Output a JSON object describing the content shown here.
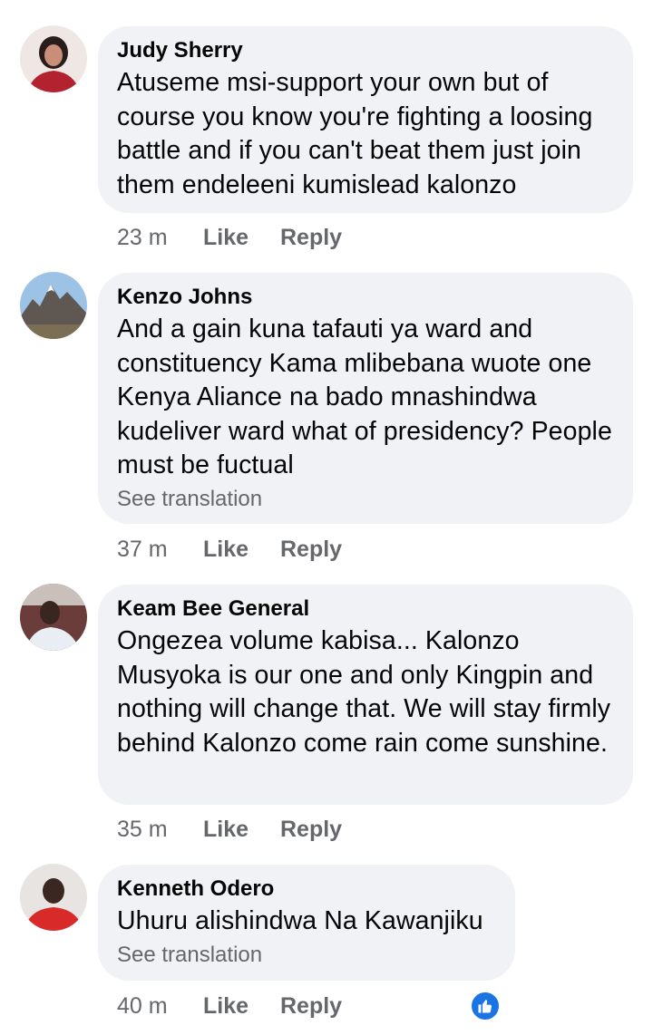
{
  "comments": [
    {
      "author": "Judy Sherry",
      "text": "Atuseme msi-support your own but of course you know you're fighting a loosing battle and if you can't beat them just join them endeleeni kumislead kalonzo",
      "time": "23 m",
      "like_label": "Like",
      "reply_label": "Reply"
    },
    {
      "author": "Kenzo Johns",
      "text": "And a gain kuna tafauti ya ward and constituency Kama mlibebana wuote one Kenya Aliance na bado mnashindwa kudeliver ward what of presidency? People must be fuctual",
      "see_translation": "See translation",
      "time": "37 m",
      "like_label": "Like",
      "reply_label": "Reply"
    },
    {
      "author": "Keam Bee General",
      "text": "Ongezea volume kabisa... Kalonzo Musyoka is our one and only Kingpin and nothing will change that. We will stay firmly behind Kalonzo come rain come sunshine.",
      "time": "35 m",
      "like_label": "Like",
      "reply_label": "Reply"
    },
    {
      "author": "Kenneth Odero",
      "text": "Uhuru alishindwa Na Kawanjiku",
      "see_translation": "See translation",
      "time": "40 m",
      "like_label": "Like",
      "reply_label": "Reply",
      "reaction_count": "1",
      "reaction_icon": "thumbs-up-icon"
    }
  ],
  "colors": {
    "bubble": "#f0f2f5",
    "text": "#050505",
    "meta": "#65676b",
    "like_blue": "#1b74e4"
  }
}
